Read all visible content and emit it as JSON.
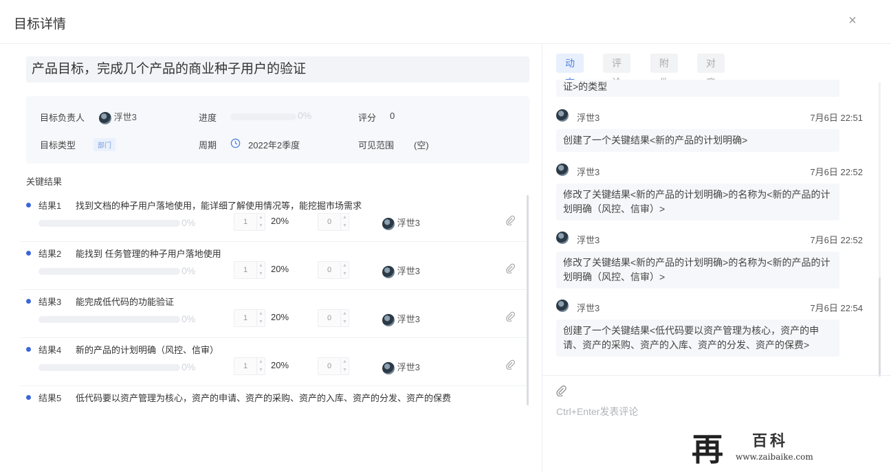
{
  "header": {
    "title": "目标详情",
    "close": "×"
  },
  "goal": {
    "title": "产品目标，完成几个产品的商业种子用户的验证",
    "owner_label": "目标负责人",
    "owner": "浮世3",
    "progress_label": "进度",
    "progress": "0%",
    "score_label": "评分",
    "score": "0",
    "type_label": "目标类型",
    "type": "部门",
    "period_label": "周期",
    "period": "2022年2季度",
    "visibility_label": "可见范围",
    "visibility": "(空)"
  },
  "key_results": {
    "heading": "关键结果",
    "items": [
      {
        "num": "结果1",
        "name": "找到文档的种子用户落地使用，能详细了解使用情况等，能挖掘市场需求",
        "progress": "0%",
        "count": "1",
        "weight": "20%",
        "score": "0",
        "owner": "浮世3"
      },
      {
        "num": "结果2",
        "name": "能找到 任务管理的种子用户落地使用",
        "progress": "0%",
        "count": "1",
        "weight": "20%",
        "score": "0",
        "owner": "浮世3"
      },
      {
        "num": "结果3",
        "name": "能完成低代码的功能验证",
        "progress": "0%",
        "count": "1",
        "weight": "20%",
        "score": "0",
        "owner": "浮世3"
      },
      {
        "num": "结果4",
        "name": "新的产品的计划明确（风控、信审）",
        "progress": "0%",
        "count": "1",
        "weight": "20%",
        "score": "0",
        "owner": "浮世3"
      },
      {
        "num": "结果5",
        "name": "低代码要以资产管理为核心，资产的申请、资产的采购、资产的入库、资产的分发、资产的保费"
      }
    ]
  },
  "tabs": [
    "动态",
    "评论",
    "附件",
    "对齐"
  ],
  "activity": {
    "partial": "证>的类型",
    "entries": [
      {
        "user": "浮世3",
        "time": "7月6日 22:51",
        "text": "创建了一个关键结果<新的产品的计划明确>"
      },
      {
        "user": "浮世3",
        "time": "7月6日 22:52",
        "text": "修改了关键结果<新的产品的计划明确>的名称为<新的产品的计划明确（风控、信审）>"
      },
      {
        "user": "浮世3",
        "time": "7月6日 22:52",
        "text": "修改了关键结果<新的产品的计划明确>的名称为<新的产品的计划明确（风控、信审）>"
      },
      {
        "user": "浮世3",
        "time": "7月6日 22:54",
        "text": "创建了一个关键结果<低代码要以资产管理为核心，资产的申请、资产的采购、资产的入库、资产的分发、资产的保费>"
      }
    ]
  },
  "composer": {
    "placeholder": "Ctrl+Enter发表评论"
  },
  "watermark": {
    "site_name": "百科",
    "url": "www.zaibaike.com"
  },
  "colors": {
    "accent": "#3b66d8",
    "tab_active_bg": "#e8f0fd",
    "panel_bg": "#f6f8fb"
  },
  "icons": [
    "close-icon",
    "clock-icon",
    "paperclip-icon",
    "avatar"
  ]
}
